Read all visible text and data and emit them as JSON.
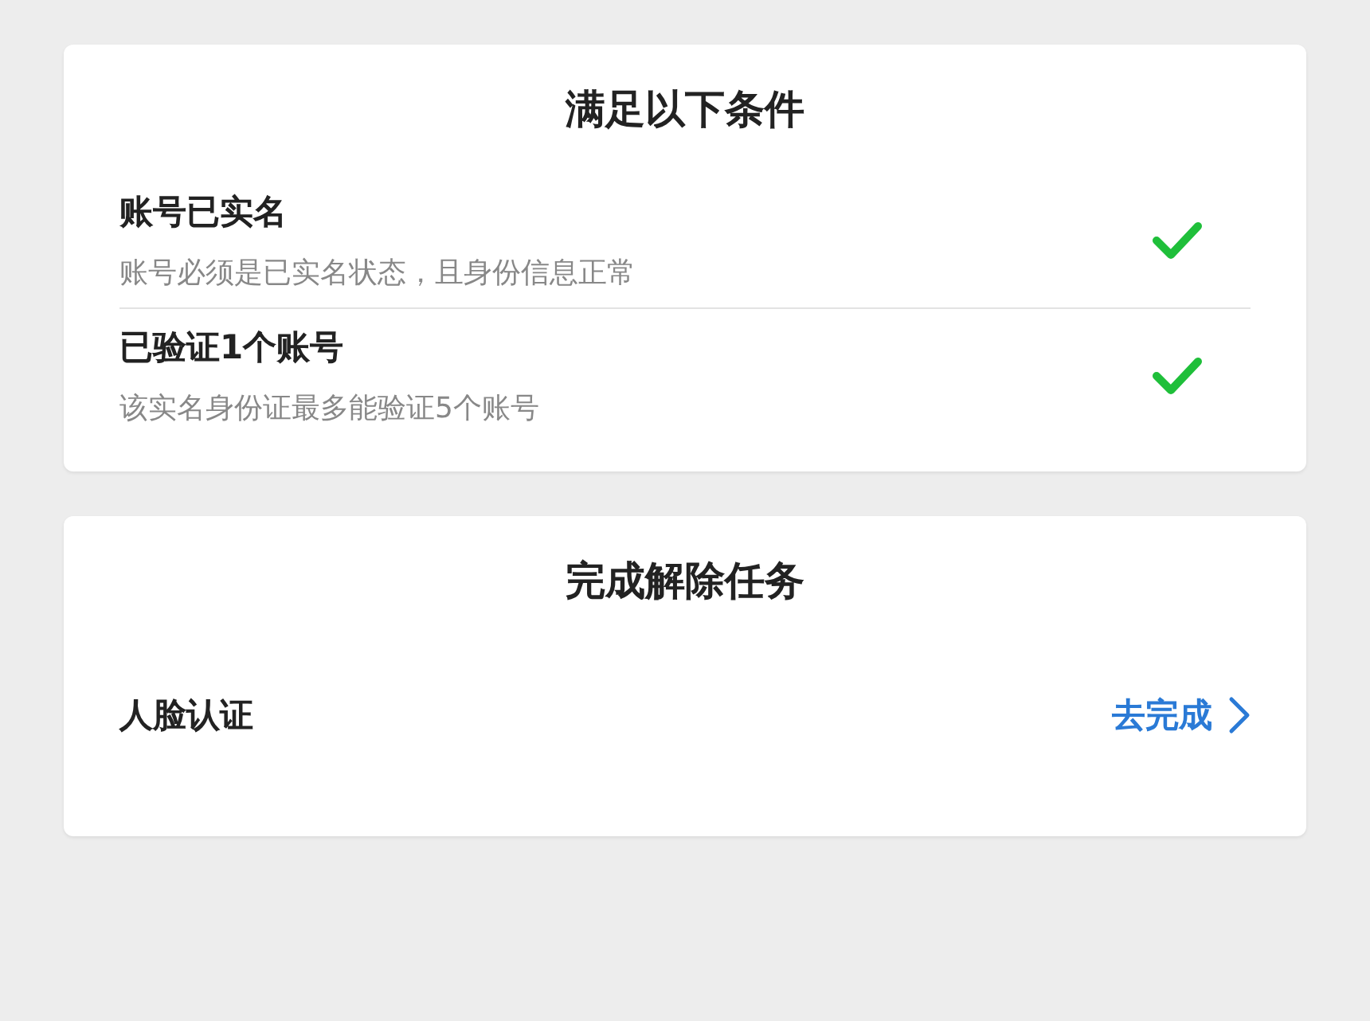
{
  "conditions_card": {
    "title": "满足以下条件",
    "items": [
      {
        "title": "账号已实名",
        "description": "账号必须是已实名状态，且身份信息正常",
        "met": true
      },
      {
        "title": "已验证1个账号",
        "description": "该实名身份证最多能验证5个账号",
        "met": true
      }
    ]
  },
  "tasks_card": {
    "title": "完成解除任务",
    "items": [
      {
        "label": "人脸认证",
        "action": "去完成"
      }
    ]
  }
}
